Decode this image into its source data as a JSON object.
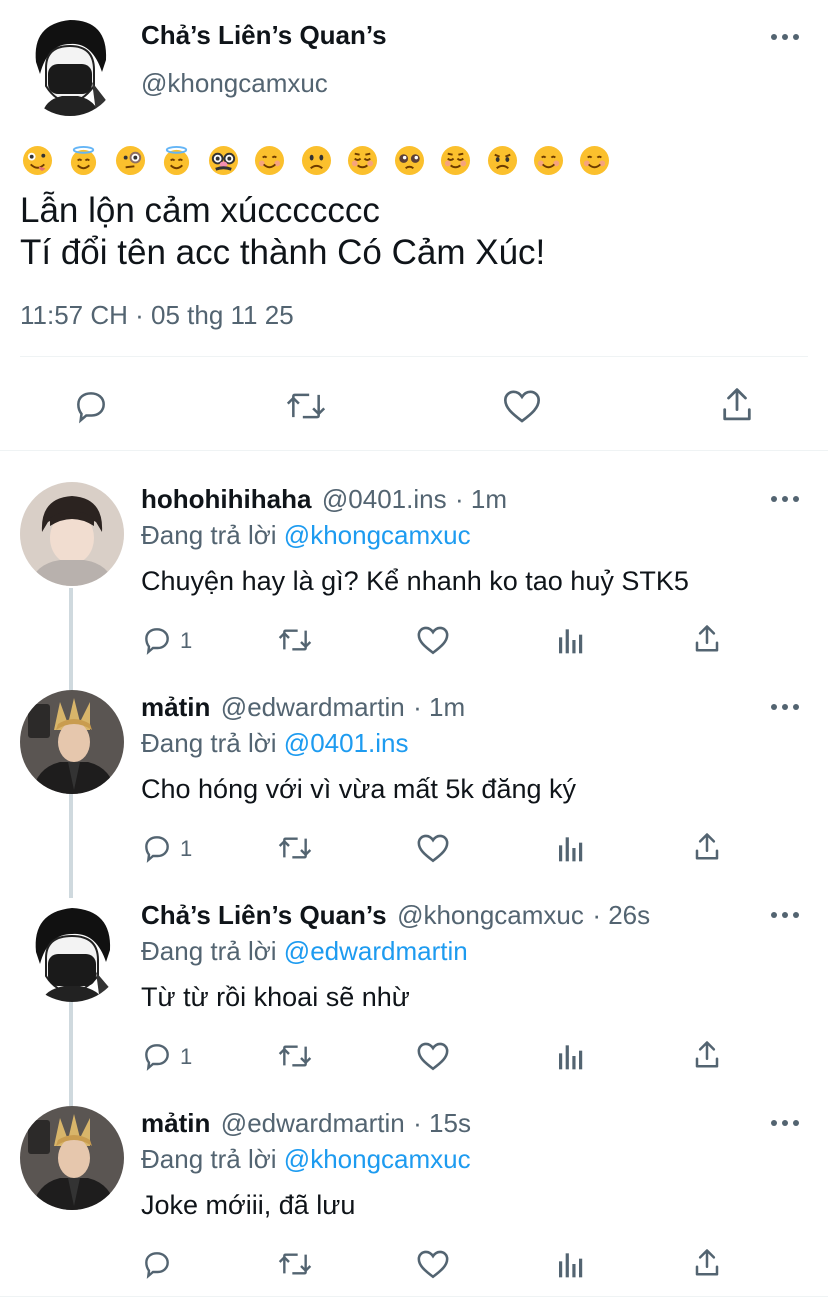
{
  "main_tweet": {
    "display_name": "Chả’s Liên’s Quan’s",
    "handle": "@khongcamxuc",
    "emojis": [
      "zany-face-emoji",
      "halo-face-emoji",
      "monocle-face-emoji",
      "halo-face-emoji",
      "disguised-face-emoji",
      "smiling-face-emoji",
      "slightly-frowning-face-emoji",
      "relieved-face-emoji",
      "pleading-face-emoji",
      "relieved-face-emoji",
      "frowning-face-emoji",
      "smiling-face-emoji",
      "smiling-face-emoji"
    ],
    "text_line1": "Lẫn lộn cảm xúccccccc",
    "text_line2": "Tí đổi tên acc thành Có Cảm Xúc!",
    "timestamp": "11:57 CH · 05 thg 11 25"
  },
  "replies": [
    {
      "display_name": "hohohihihaha",
      "handle": "@0401.ins",
      "time": "· 1m",
      "replying_prefix": "Đang trả lời",
      "replying_to": "@khongcamxuc",
      "text": "Chuyện hay là gì? Kể nhanh ko tao huỷ STK5",
      "reply_count": "1"
    },
    {
      "display_name": "mảtin",
      "handle": "@edwardmartin",
      "time": "· 1m",
      "replying_prefix": "Đang trả lời",
      "replying_to": "@0401.ins",
      "text": "Cho hóng với vì vừa mất 5k đăng ký",
      "reply_count": "1"
    },
    {
      "display_name": "Chả’s Liên’s Quan’s",
      "handle": "@khongcamxuc",
      "time": "· 26s",
      "replying_prefix": "Đang trả lời",
      "replying_to": "@edwardmartin",
      "text": "Từ từ rồi khoai sẽ nhừ",
      "reply_count": "1"
    },
    {
      "display_name": "mảtin",
      "handle": "@edwardmartin",
      "time": "· 15s",
      "replying_prefix": "Đang trả lời",
      "replying_to": "@khongcamxuc",
      "text": "Joke mớiii, đã lưu",
      "reply_count": ""
    }
  ],
  "icons": {
    "reply": "reply-icon",
    "retweet": "retweet-icon",
    "like": "like-icon",
    "analytics": "analytics-icon",
    "share": "share-icon",
    "more": "more-icon"
  },
  "colors": {
    "link": "#1d9bf0",
    "secondary": "#536471",
    "divider": "#eff3f4",
    "thread_line": "#cfd9de"
  }
}
